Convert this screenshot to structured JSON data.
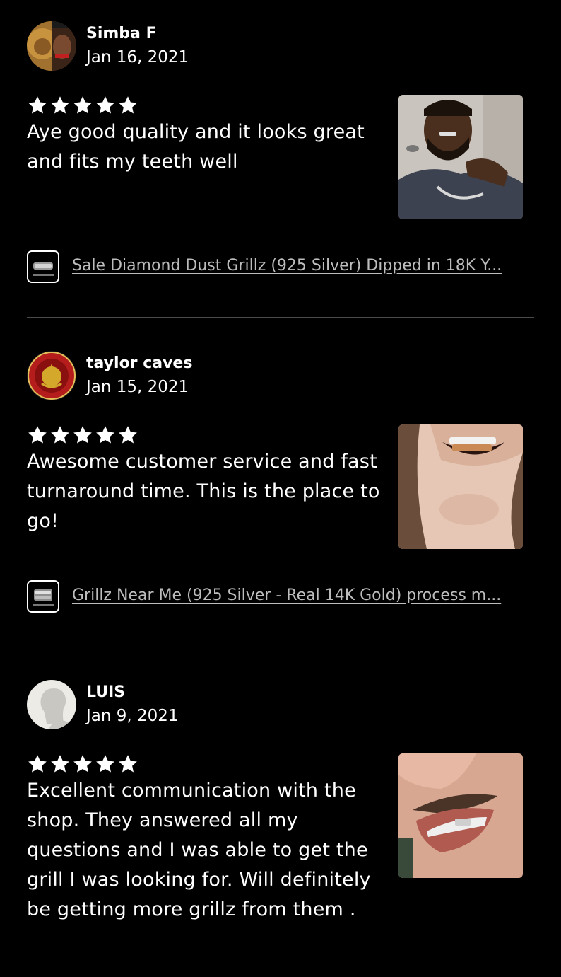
{
  "reviews": [
    {
      "name": "Simba F",
      "date": "Jan 16, 2021",
      "rating": 5,
      "text": "Aye good quality and it looks great and fits my teeth well",
      "item_title": "Sale Diamond Dust Grillz (925 Silver) Dipped in 18K Y..."
    },
    {
      "name": "taylor caves",
      "date": "Jan 15, 2021",
      "rating": 5,
      "text": "Awesome customer service and fast turnaround time. This is the place to go!",
      "item_title": "Grillz Near Me (925 Silver - Real 14K Gold) process m..."
    },
    {
      "name": "LUIS",
      "date": "Jan 9, 2021",
      "rating": 5,
      "text": "Excellent communication with the shop. They answered all my questions and I was able to get the grill I was looking for. Will definitely be getting more grillz from them ."
    }
  ],
  "icons": {
    "star": "star-icon",
    "default_avatar": "person-silhouette-icon"
  },
  "colors": {
    "background": "#000000",
    "text": "#ffffff",
    "link": "#bdbdbd",
    "divider": "#4a4a4a"
  }
}
